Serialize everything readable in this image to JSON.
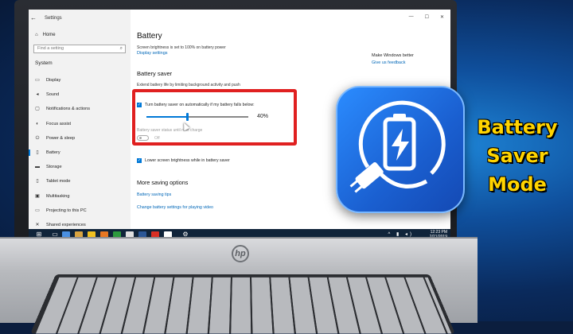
{
  "window": {
    "title": "Settings",
    "controls": [
      "—",
      "☐",
      "✕"
    ]
  },
  "sidebar": {
    "home": "Home",
    "search_placeholder": "Find a setting",
    "section": "System",
    "items": [
      {
        "label": "Display",
        "icon": "display-icon",
        "active": false
      },
      {
        "label": "Sound",
        "icon": "sound-icon",
        "active": false
      },
      {
        "label": "Notifications & actions",
        "icon": "notifications-icon",
        "active": false
      },
      {
        "label": "Focus assist",
        "icon": "focus-assist-icon",
        "active": false
      },
      {
        "label": "Power & sleep",
        "icon": "power-icon",
        "active": false
      },
      {
        "label": "Battery",
        "icon": "battery-icon",
        "active": true
      },
      {
        "label": "Storage",
        "icon": "storage-icon",
        "active": false
      },
      {
        "label": "Tablet mode",
        "icon": "tablet-icon",
        "active": false
      },
      {
        "label": "Multitasking",
        "icon": "multitasking-icon",
        "active": false
      },
      {
        "label": "Projecting to this PC",
        "icon": "projecting-icon",
        "active": false
      },
      {
        "label": "Shared experiences",
        "icon": "shared-icon",
        "active": false
      }
    ]
  },
  "main": {
    "title": "Battery",
    "brightness_note": "Screen brightness is set to 100% on battery power",
    "display_link": "Display settings",
    "make_better": "Make Windows better",
    "feedback_link": "Give us feedback",
    "saver_heading": "Battery saver",
    "extend_note": "Extend battery life by limiting background activity and push",
    "auto_label": "Turn battery saver on automatically if my battery falls below:",
    "threshold_value": "40%",
    "threshold_fraction": 0.4,
    "status_until": "Battery saver status until next charge",
    "toggle_state": "Off",
    "lower_brightness_label": "Lower screen brightness while in battery saver",
    "more_heading": "More saving options",
    "tips_link": "Battery saving tips",
    "video_link": "Change battery settings for playing video"
  },
  "taskbar": {
    "time": "12:23 PM",
    "date": "2/21/2019"
  },
  "hero": {
    "line1": "Battery",
    "line2": "Saver",
    "line3": "Mode"
  },
  "laptop": {
    "brand": "hp"
  },
  "colors": {
    "accent": "#0078d7",
    "highlight_box": "#e02020",
    "hero_text": "#ffd400",
    "app_icon": "#2b8cff"
  }
}
